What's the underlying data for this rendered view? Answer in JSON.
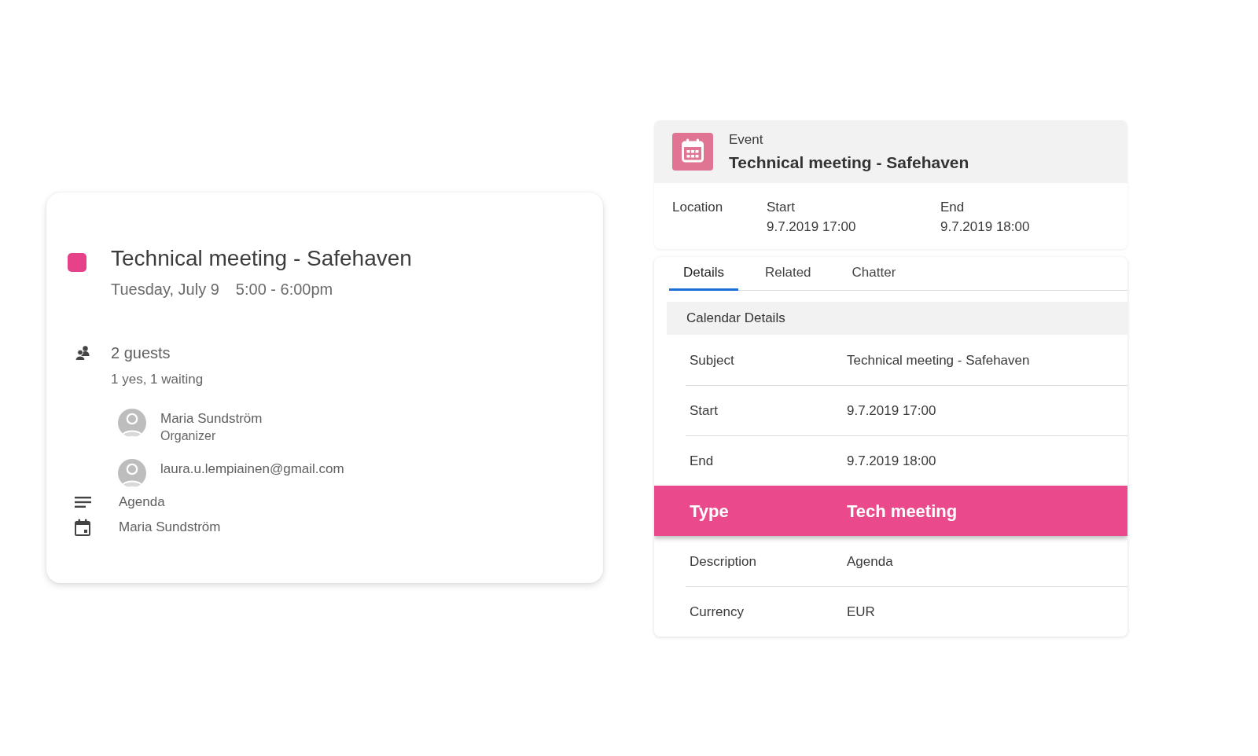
{
  "event_card": {
    "color": "#e6428a",
    "title": "Technical meeting - Safehaven",
    "date": "Tuesday, July 9",
    "time": "5:00 - 6:00pm",
    "guest_count": "2 guests",
    "guest_summary": "1 yes, 1 waiting",
    "guests": [
      {
        "name": "Maria Sundström",
        "role": "Organizer"
      },
      {
        "name": "laura.u.lempiainen@gmail.com"
      }
    ],
    "details": [
      {
        "kind": "description",
        "text": "Agenda"
      },
      {
        "kind": "calendar",
        "text": "Maria Sundström"
      }
    ]
  },
  "record": {
    "object_type": "Event",
    "title": "Technical meeting - Safehaven",
    "highlights": [
      {
        "label": "Location"
      },
      {
        "label": "Start",
        "value": "9.7.2019 17:00"
      },
      {
        "label": "End",
        "value": "9.7.2019 18:00"
      }
    ],
    "tabs": [
      {
        "label": "Details",
        "selected": true
      },
      {
        "label": "Related",
        "selected": false
      },
      {
        "label": "Chatter",
        "selected": false
      }
    ],
    "section": {
      "title": "Calendar Details",
      "fields": [
        {
          "label": "Subject",
          "value": "Technical meeting - Safehaven",
          "highlighted": false
        },
        {
          "label": "Start",
          "value": "9.7.2019 17:00",
          "highlighted": false
        },
        {
          "label": "End",
          "value": "9.7.2019 18:00",
          "highlighted": false
        },
        {
          "label": "Type",
          "value": "Tech meeting",
          "highlighted": true
        },
        {
          "label": "Description",
          "value": "Agenda",
          "highlighted": false
        },
        {
          "label": "Currency",
          "value": "EUR",
          "highlighted": false
        }
      ]
    }
  }
}
